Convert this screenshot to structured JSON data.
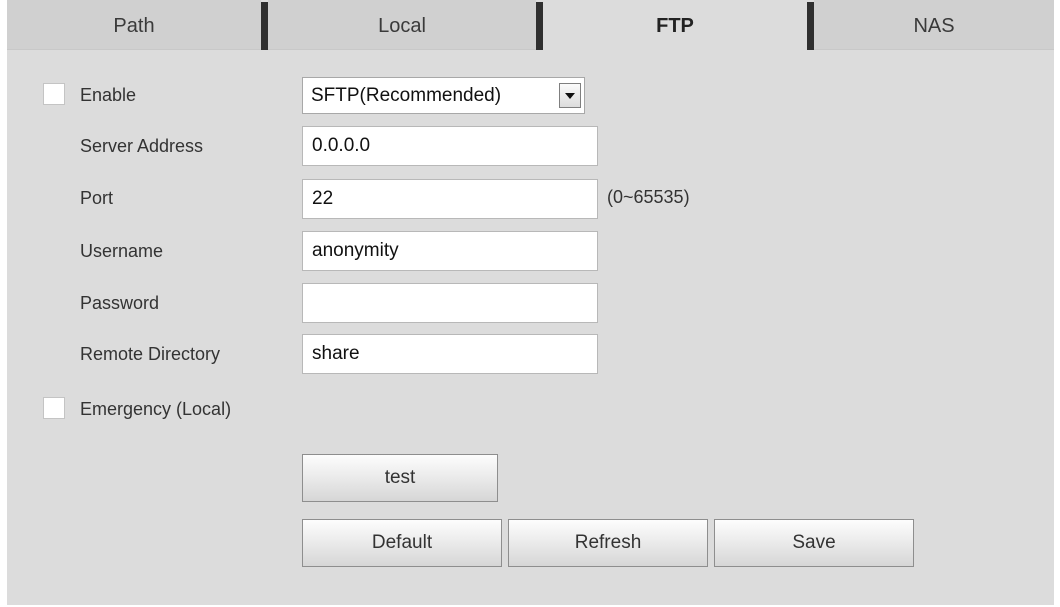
{
  "tabs": [
    {
      "label": "Path",
      "active": false
    },
    {
      "label": "Local",
      "active": false
    },
    {
      "label": "FTP",
      "active": true
    },
    {
      "label": "NAS",
      "active": false
    }
  ],
  "form": {
    "enable": {
      "label": "Enable",
      "checked": false
    },
    "protocol": {
      "selected": "SFTP(Recommended)"
    },
    "server_address": {
      "label": "Server Address",
      "value": "0.0.0.0"
    },
    "port": {
      "label": "Port",
      "value": "22",
      "hint": "(0~65535)"
    },
    "username": {
      "label": "Username",
      "value": "anonymity"
    },
    "password": {
      "label": "Password",
      "value": ""
    },
    "remote_directory": {
      "label": "Remote Directory",
      "value": "share"
    },
    "emergency": {
      "label": "Emergency (Local)",
      "checked": false
    }
  },
  "buttons": {
    "test": "test",
    "default": "Default",
    "refresh": "Refresh",
    "save": "Save"
  },
  "colors": {
    "panel_bg": "#dcdcdc",
    "tab_bg": "#d0d0d0",
    "tab_separator": "#2f2f2f"
  },
  "icons": {
    "dropdown": "dropdown-arrow-icon"
  }
}
